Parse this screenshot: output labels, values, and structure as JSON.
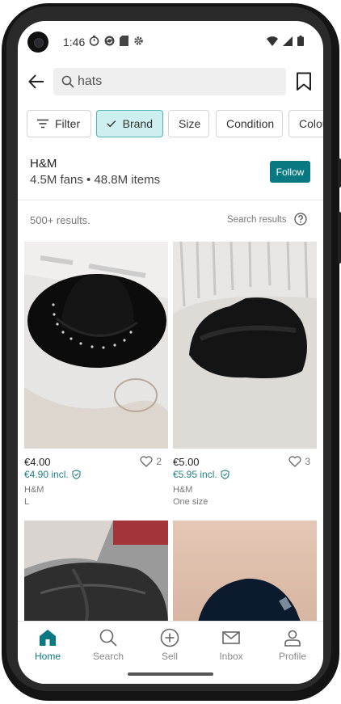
{
  "status_bar": {
    "time": "1:46"
  },
  "search": {
    "query": "hats"
  },
  "filters": [
    {
      "label": "Filter"
    },
    {
      "label": "Brand"
    },
    {
      "label": "Size"
    },
    {
      "label": "Condition"
    },
    {
      "label": "Colou"
    }
  ],
  "brand": {
    "name": "H&M",
    "stats": "4.5M fans • 48.8M items",
    "follow_label": "Follow"
  },
  "results": {
    "count": "500+ results.",
    "search_results_label": "Search results"
  },
  "items": [
    {
      "price": "€4.00",
      "price_incl": "€4.90 incl.",
      "brand": "H&M",
      "size": "L",
      "favorites": "2"
    },
    {
      "price": "€5.00",
      "price_incl": "€5.95 incl.",
      "brand": "H&M",
      "size": "One size",
      "favorites": "3"
    }
  ],
  "bottom_nav": [
    {
      "label": "Home"
    },
    {
      "label": "Search"
    },
    {
      "label": "Sell"
    },
    {
      "label": "Inbox"
    },
    {
      "label": "Profile"
    }
  ],
  "colors": {
    "accent": "#087882",
    "chip_active_bg": "#cdeff0",
    "incl_price": "#1f7f86"
  }
}
